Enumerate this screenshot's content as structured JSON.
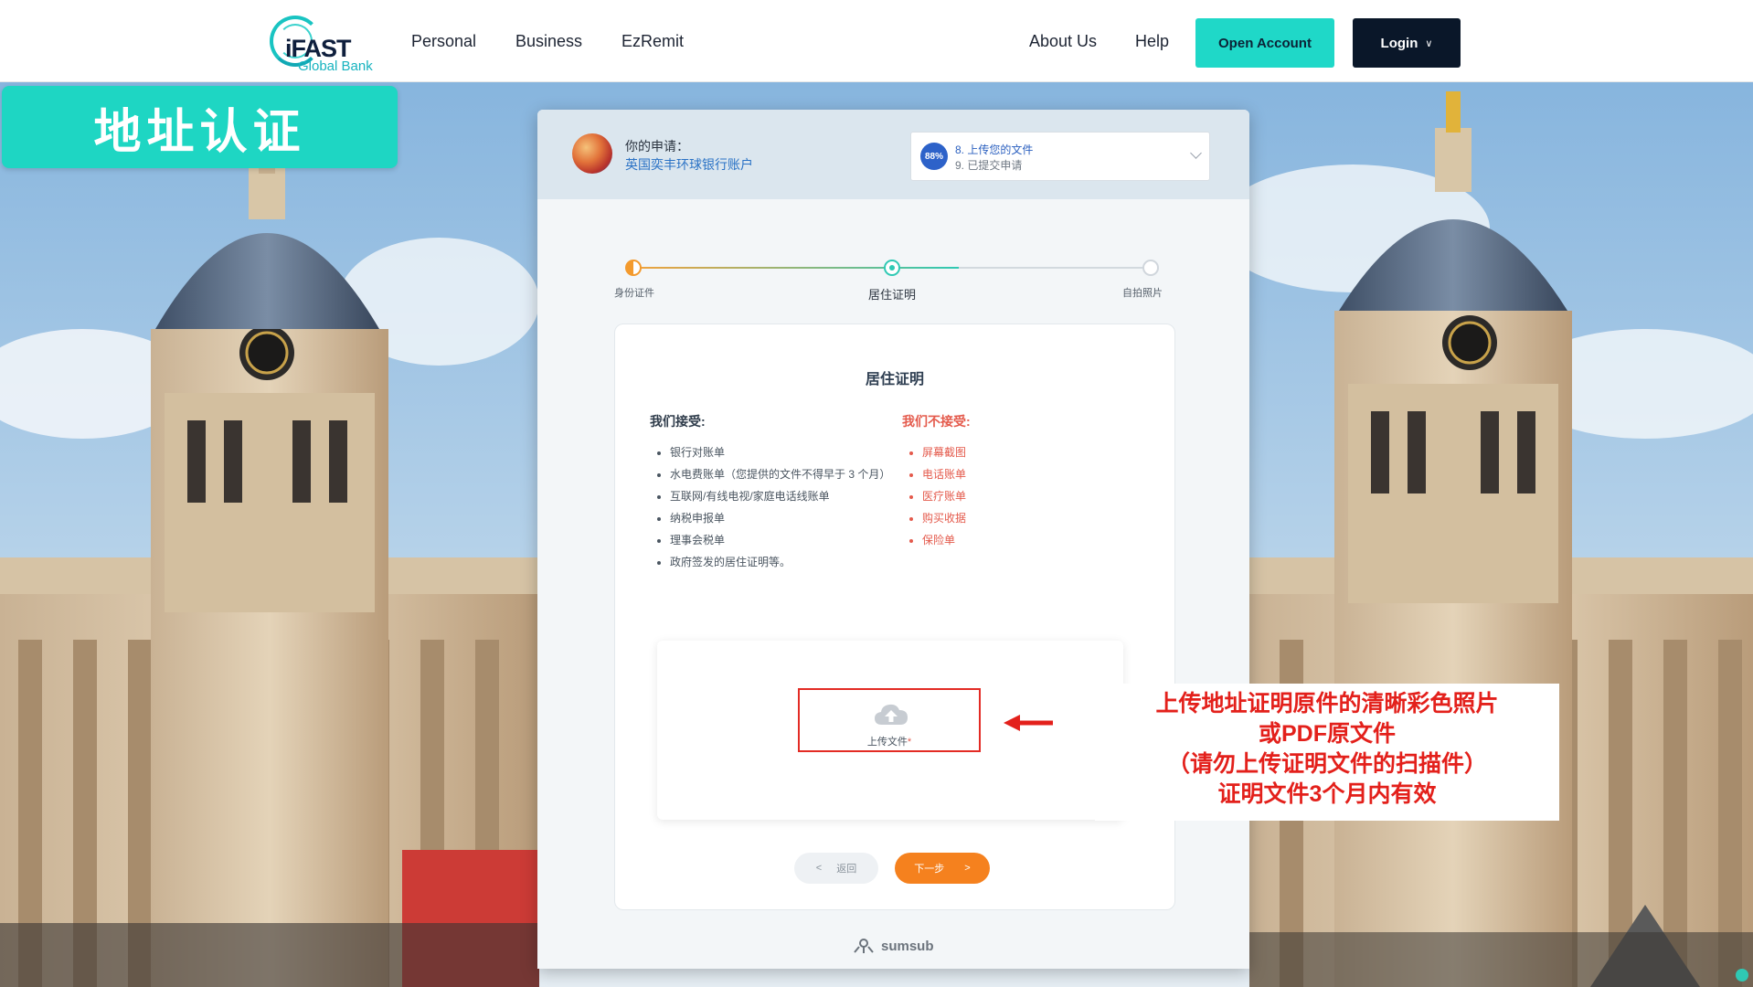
{
  "nav": {
    "logo_name": "iFAST",
    "logo_sub": "Global Bank",
    "items": [
      "Personal",
      "Business",
      "EzRemit"
    ],
    "right_items": [
      "About Us",
      "Help"
    ],
    "open_account": "Open Account",
    "login": "Login"
  },
  "badge": "地址认证",
  "application": {
    "label": "你的申请：",
    "value": "英国奕丰环球银行账户"
  },
  "step_select": {
    "percent": "88%",
    "current": "8. 上传您的文件",
    "next": "9. 已提交申请"
  },
  "progress": {
    "steps": [
      "身份证件",
      "居住证明",
      "自拍照片"
    ],
    "active_index": 1,
    "fill_fraction": 0.63
  },
  "card": {
    "title": "居住证明",
    "accepted_title": "我们接受:",
    "accepted": [
      "银行对账单",
      "水电费账单（您提供的文件不得早于 3 个月）",
      "互联网/有线电视/家庭电话线账单",
      "纳税申报单",
      "理事会税单",
      "政府签发的居住证明等。"
    ],
    "rejected_title": "我们不接受:",
    "rejected": [
      "屏幕截图",
      "电话账单",
      "医疗账单",
      "购买收据",
      "保险单"
    ],
    "upload_label": "上传文件",
    "upload_required": "*",
    "back": "返回",
    "next": "下一步"
  },
  "powered_by": "sumsub",
  "annotation": [
    "上传地址证明原件的清晰彩色照片",
    "或PDF原文件",
    "（请勿上传证明文件的扫描件）",
    "证明文件3个月内有效"
  ],
  "colors": {
    "brand_teal": "#1ed6c3",
    "login_dark": "#0a1729",
    "next_orange": "#f5811e",
    "annotation_red": "#e3201b"
  }
}
